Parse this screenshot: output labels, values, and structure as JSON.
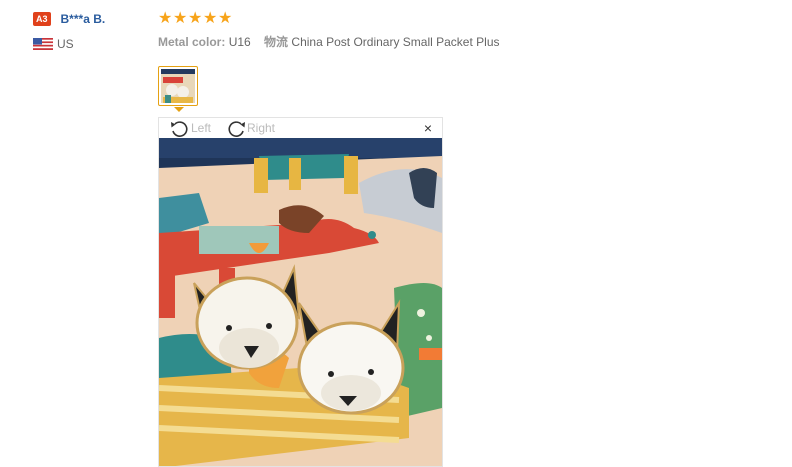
{
  "user": {
    "level": "A3",
    "name": "B***a B.",
    "country": "US"
  },
  "review": {
    "rating": 5,
    "stars": [
      "★",
      "★",
      "★",
      "★",
      "★"
    ],
    "color_label": "Metal color:",
    "color_value": "U16",
    "shipping_label": "物流",
    "shipping_value": "China Post Ordinary Small Packet Plus"
  },
  "viewer": {
    "rotate_left_label": "Left",
    "rotate_right_label": "Right",
    "close_label": "×"
  },
  "colors": {
    "badge": "#e0411b",
    "username": "#2a5c9e",
    "star": "#f7a41b",
    "thumb_border": "#e5a113"
  }
}
